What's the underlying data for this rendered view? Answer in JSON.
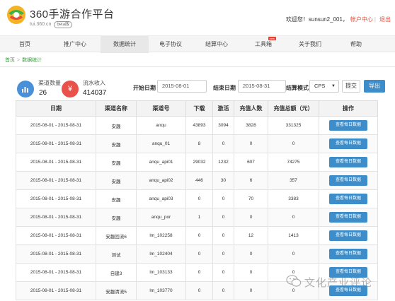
{
  "header": {
    "brand_title": "360手游合作平台",
    "brand_url": "tui.360.cn",
    "beta_label": "beta版",
    "welcome": "欢迎您！sunsun2_001，",
    "account_center": "帐户中心",
    "logout": "退出"
  },
  "nav": {
    "items": [
      {
        "label": "首页"
      },
      {
        "label": "推广中心"
      },
      {
        "label": "数据统计"
      },
      {
        "label": "电子协议"
      },
      {
        "label": "结算中心"
      },
      {
        "label": "工具箱"
      },
      {
        "label": "关于我们"
      },
      {
        "label": "帮助"
      }
    ],
    "active_index": 2,
    "hot_badge": "new"
  },
  "breadcrumb": {
    "home": "首页",
    "current": "数据统计",
    "separator": ">"
  },
  "stats": {
    "channel_count_label": "渠道数量",
    "channel_count_value": "26",
    "revenue_label": "流水收入",
    "revenue_value": "414037",
    "revenue_symbol": "¥"
  },
  "filter": {
    "start_label": "开始日期",
    "start_value": "2015-08-01",
    "end_label": "结束日期",
    "end_value": "2015-08-31",
    "mode_label": "结算模式",
    "mode_value": "CPS",
    "submit_label": "提交",
    "export_label": "导出"
  },
  "table": {
    "headers": [
      "日期",
      "渠道名称",
      "渠道号",
      "下载",
      "激活",
      "充值人数",
      "充值总额（元）",
      "操作"
    ],
    "action_label": "查看每日数据",
    "rows": [
      [
        "2015-08-01 - 2015-08-31",
        "安趣",
        "anqu",
        "43893",
        "3094",
        "3828",
        "331325"
      ],
      [
        "2015-08-01 - 2015-08-31",
        "安趣",
        "anqu_01",
        "8",
        "0",
        "0",
        "0"
      ],
      [
        "2015-08-01 - 2015-08-31",
        "安趣",
        "anqu_api01",
        "29032",
        "1232",
        "607",
        "74275"
      ],
      [
        "2015-08-01 - 2015-08-31",
        "安趣",
        "anqu_api02",
        "446",
        "30",
        "6",
        "357"
      ],
      [
        "2015-08-01 - 2015-08-31",
        "安趣",
        "anqu_api03",
        "0",
        "0",
        "70",
        "3383"
      ],
      [
        "2015-08-01 - 2015-08-31",
        "安趣",
        "anqu_por",
        "1",
        "0",
        "0",
        "0"
      ],
      [
        "2015-08-01 - 2015-08-31",
        "安趣回流6",
        "lm_102258",
        "0",
        "0",
        "12",
        "1413"
      ],
      [
        "2015-08-01 - 2015-08-31",
        "测试",
        "lm_102404",
        "0",
        "0",
        "0",
        "0"
      ],
      [
        "2015-08-01 - 2015-08-31",
        "自建3",
        "lm_103133",
        "0",
        "0",
        "0",
        "0"
      ],
      [
        "2015-08-01 - 2015-08-31",
        "安趣清流5",
        "lm_103770",
        "0",
        "0",
        "0",
        "0"
      ]
    ]
  },
  "watermark": {
    "text": "文化产业评论"
  },
  "colors": {
    "accent_blue": "#3c8dc9",
    "accent_red": "#e84c3d",
    "breadcrumb_green": "#3a9e3f"
  },
  "icons": {
    "logo": "360-logo-icon",
    "channel": "bar-chart-icon",
    "revenue": "yuan-icon",
    "watermark": "wechat-icon"
  }
}
